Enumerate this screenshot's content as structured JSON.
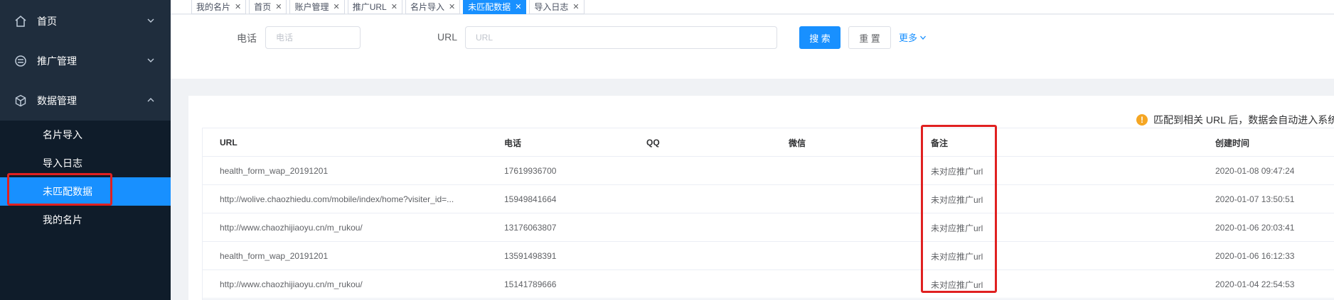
{
  "sidebar": {
    "menus": [
      {
        "label": "首页",
        "icon": "home-icon",
        "expanded": false
      },
      {
        "label": "推广管理",
        "icon": "promotion-icon",
        "expanded": false
      },
      {
        "label": "数据管理",
        "icon": "data-cube-icon",
        "expanded": true
      }
    ],
    "submenu": [
      {
        "label": "名片导入",
        "active": false
      },
      {
        "label": "导入日志",
        "active": false
      },
      {
        "label": "未匹配数据",
        "active": true
      },
      {
        "label": "我的名片",
        "active": false
      }
    ]
  },
  "tabs": [
    {
      "label": "我的名片",
      "active": false
    },
    {
      "label": "首页",
      "active": false
    },
    {
      "label": "账户管理",
      "active": false
    },
    {
      "label": "推广URL",
      "active": false
    },
    {
      "label": "名片导入",
      "active": false
    },
    {
      "label": "未匹配数据",
      "active": true
    },
    {
      "label": "导入日志",
      "active": false
    }
  ],
  "search": {
    "phone_label": "电话",
    "phone_placeholder": "电话",
    "url_label": "URL",
    "url_placeholder": "URL",
    "search_button": "搜 索",
    "reset_button": "重 置",
    "more_link": "更多"
  },
  "notice": "匹配到相关 URL 后，数据会自动进入系统",
  "table": {
    "columns": [
      "URL",
      "电话",
      "QQ",
      "微信",
      "备注",
      "创建时间"
    ],
    "rows": [
      {
        "url": "health_form_wap_20191201",
        "phone": "17619936700",
        "qq": "",
        "wechat": "",
        "remark": "未对应推广url",
        "created": "2020-01-08 09:47:24"
      },
      {
        "url": "http://wolive.chaozhiedu.com/mobile/index/home?visiter_id=...",
        "phone": "15949841664",
        "qq": "",
        "wechat": "",
        "remark": "未对应推广url",
        "created": "2020-01-07 13:50:51"
      },
      {
        "url": "http://www.chaozhijiaoyu.cn/m_rukou/",
        "phone": "13176063807",
        "qq": "",
        "wechat": "",
        "remark": "未对应推广url",
        "created": "2020-01-06 20:03:41"
      },
      {
        "url": "health_form_wap_20191201",
        "phone": "13591498391",
        "qq": "",
        "wechat": "",
        "remark": "未对应推广url",
        "created": "2020-01-06 16:12:33"
      },
      {
        "url": "http://www.chaozhijiaoyu.cn/m_rukou/",
        "phone": "15141789666",
        "qq": "",
        "wechat": "",
        "remark": "未对应推广url",
        "created": "2020-01-04 22:54:53"
      }
    ]
  },
  "colors": {
    "sidebar_bg": "#1f2d3d",
    "submenu_bg": "#0f1c2a",
    "accent": "#1890ff",
    "highlight_box": "#e02020",
    "warning": "#f5a623"
  }
}
